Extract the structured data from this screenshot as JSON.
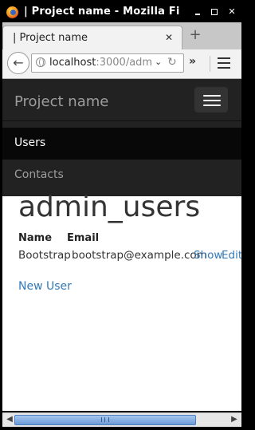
{
  "window": {
    "title": "| Project name - Mozilla Fi"
  },
  "tabs": [
    {
      "label": "| Project name",
      "close_icon": "close-icon"
    }
  ],
  "new_tab_icon": "plus-icon",
  "navbar": {
    "url_host": "localhost",
    "url_path": ":3000/adm"
  },
  "page": {
    "brand": "Project name",
    "nav_items": [
      "Users",
      "Contacts"
    ],
    "heading": "admin_users",
    "table": {
      "headers": [
        "Name",
        "Email"
      ],
      "rows": [
        {
          "name": "Bootstrap",
          "email": "bootstrap@example.com",
          "actions": [
            "Show",
            "Edit"
          ]
        }
      ]
    },
    "new_user_link": "New User"
  },
  "colors": {
    "navbar_bg": "#222222",
    "active_nav_bg": "#080808",
    "link": "#337ab7"
  }
}
